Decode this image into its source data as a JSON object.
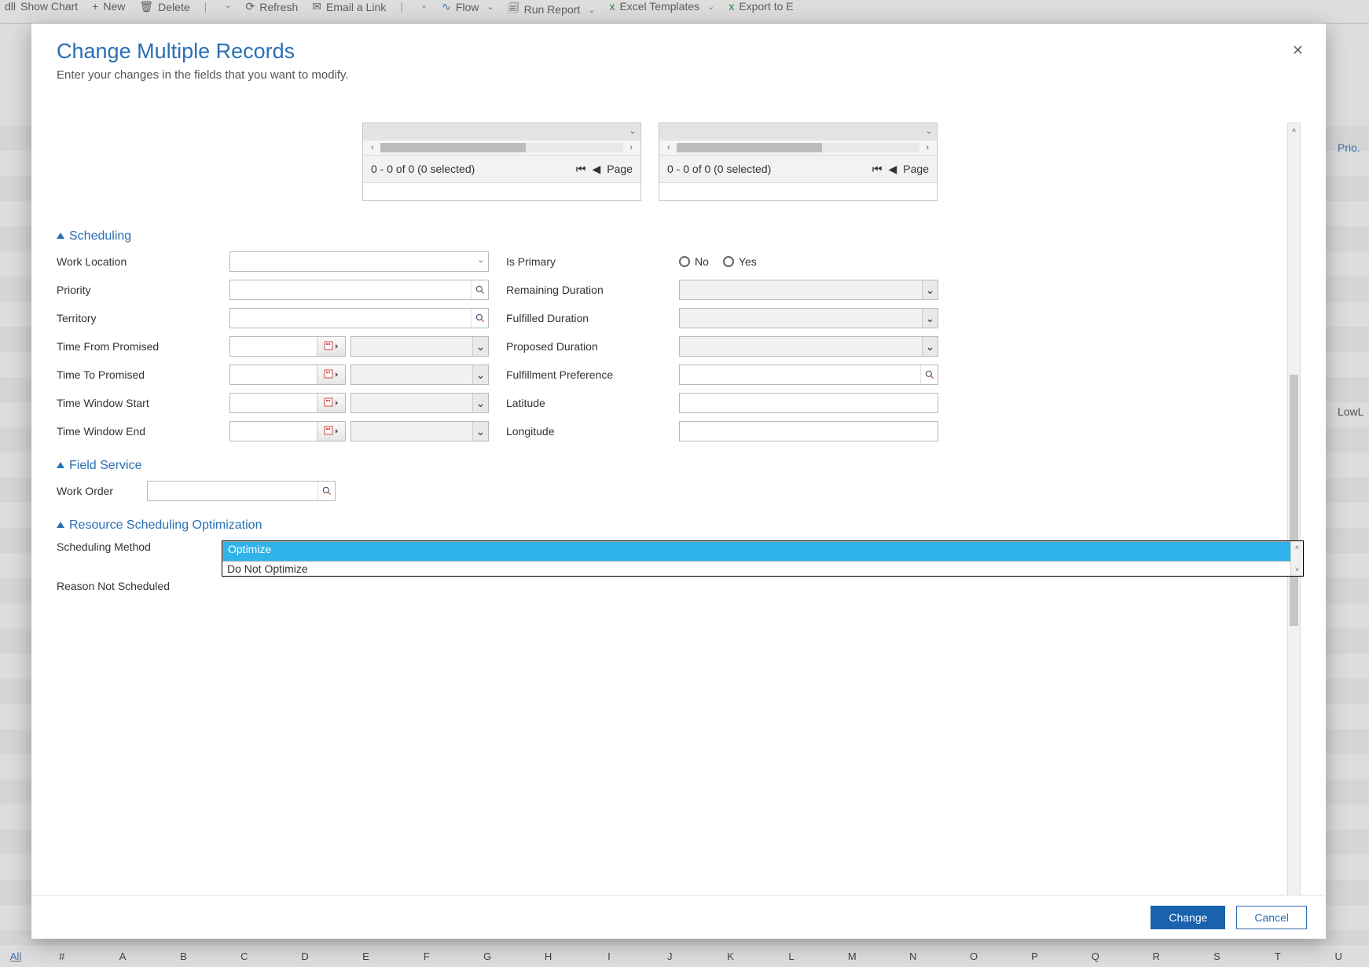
{
  "toolbar": {
    "show_chart": "Show Chart",
    "new": "New",
    "delete": "Delete",
    "refresh": "Refresh",
    "email_link": "Email a Link",
    "flow": "Flow",
    "run_report": "Run Report",
    "excel_templates": "Excel Templates",
    "export_excel": "Export to E"
  },
  "bg": {
    "right_header": "Prio.",
    "right_cell": "LowL",
    "alpha_all": "All",
    "alpha": [
      "#",
      "A",
      "B",
      "C",
      "D",
      "E",
      "F",
      "G",
      "H",
      "I",
      "J",
      "K",
      "L",
      "M",
      "N",
      "O",
      "P",
      "Q",
      "R",
      "S",
      "T",
      "U"
    ]
  },
  "modal": {
    "title": "Change Multiple Records",
    "subtitle": "Enter your changes in the fields that you want to modify.",
    "close": "✕",
    "panel_count": "0 - 0 of 0 (0 selected)",
    "panel_page": "Page",
    "sections": {
      "scheduling": "Scheduling",
      "field_service": "Field Service",
      "rso": "Resource Scheduling Optimization"
    },
    "labels": {
      "work_location": "Work Location",
      "priority": "Priority",
      "territory": "Territory",
      "time_from": "Time From Promised",
      "time_to": "Time To Promised",
      "tw_start": "Time Window Start",
      "tw_end": "Time Window End",
      "is_primary": "Is Primary",
      "no": "No",
      "yes": "Yes",
      "remaining_duration": "Remaining Duration",
      "fulfilled_duration": "Fulfilled Duration",
      "proposed_duration": "Proposed Duration",
      "fulfillment_pref": "Fulfillment Preference",
      "latitude": "Latitude",
      "longitude": "Longitude",
      "work_order": "Work Order",
      "sched_method": "Scheduling Method",
      "reason_not_sched": "Reason Not Scheduled"
    },
    "sched_method_options": {
      "optimize": "Optimize",
      "dont": "Do Not Optimize"
    },
    "footer": {
      "change": "Change",
      "cancel": "Cancel"
    }
  }
}
